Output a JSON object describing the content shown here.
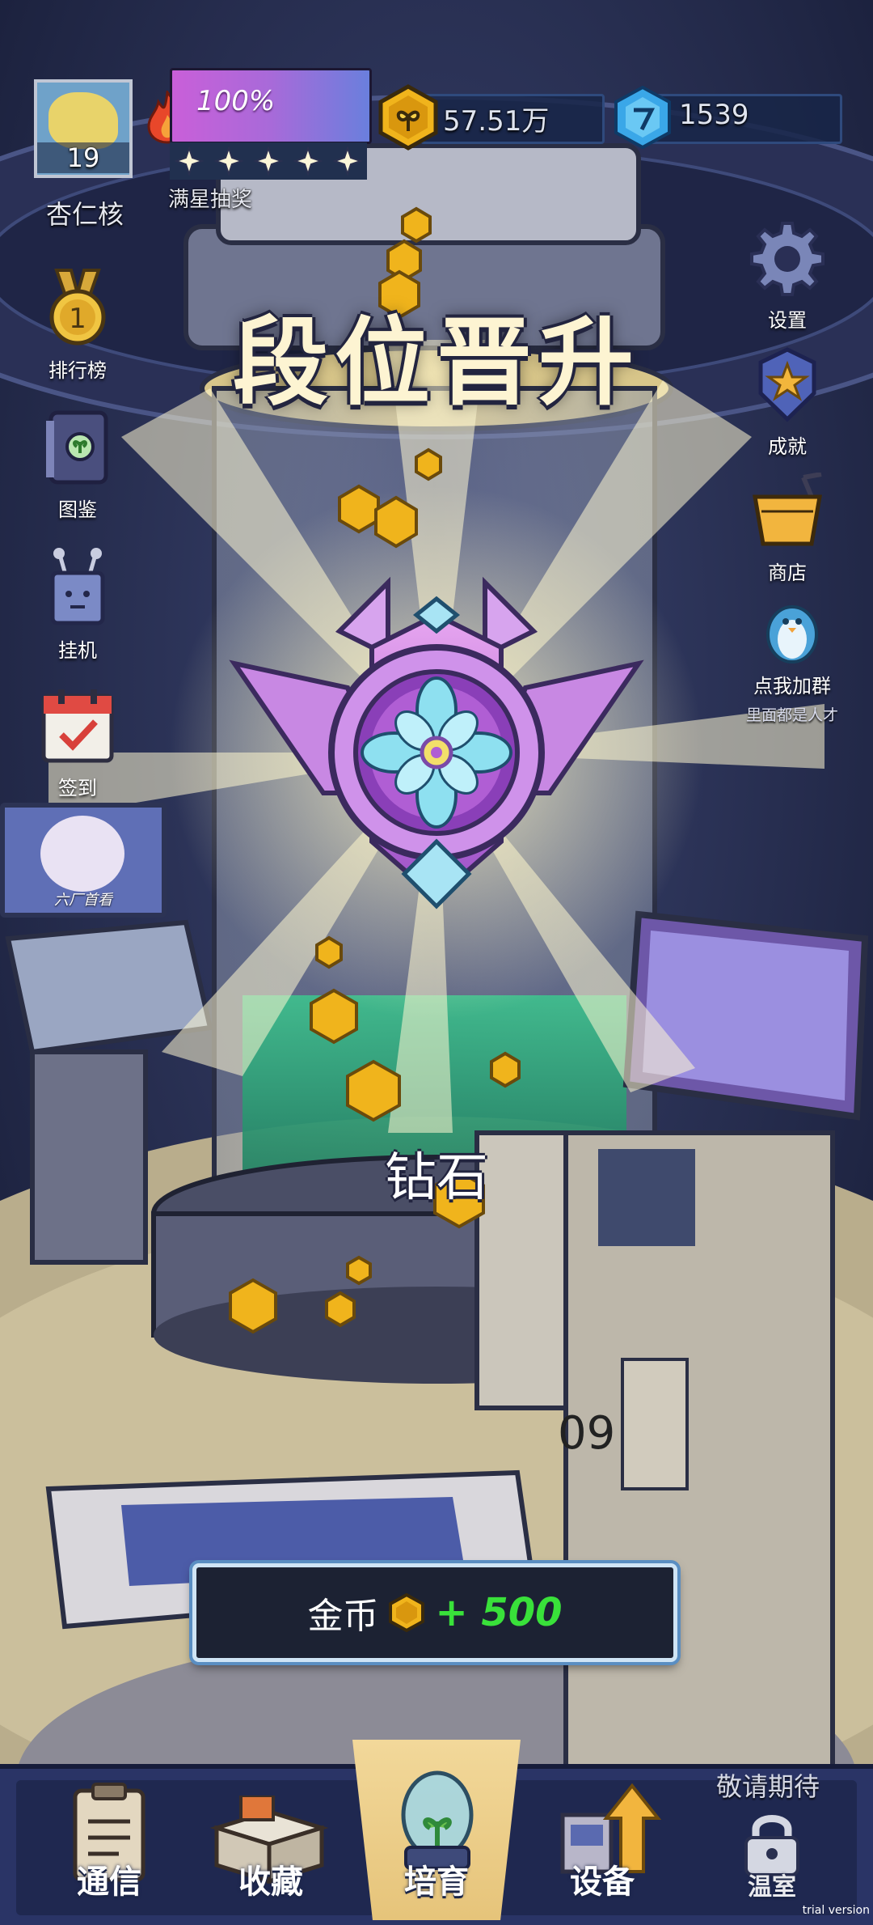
{
  "player": {
    "name": "杏仁核",
    "level": "19"
  },
  "star_bar": {
    "percent_text": "100%",
    "progress": 1.0,
    "stars_filled": 5,
    "stars_total": 5,
    "label": "满星抽奖"
  },
  "currency": {
    "coins": "57.51万",
    "gems": "1539"
  },
  "left_menu": [
    {
      "label": "排行榜",
      "icon": "medal-icon"
    },
    {
      "label": "图鉴",
      "icon": "book-icon"
    },
    {
      "label": "挂机",
      "icon": "robot-icon"
    },
    {
      "label": "签到",
      "icon": "calendar-icon"
    }
  ],
  "ad_banner": {
    "label": "六厂首看"
  },
  "right_menu": [
    {
      "label": "设置",
      "icon": "gear-icon"
    },
    {
      "label": "成就",
      "icon": "achievement-icon"
    },
    {
      "label": "商店",
      "icon": "shop-icon"
    },
    {
      "label": "点我加群",
      "sub": "里面都是人才",
      "icon": "penguin-icon"
    }
  ],
  "promotion": {
    "title": "段位晋升",
    "rank_name": "钻石",
    "reward_label": "金币",
    "reward_amount": "+ 500"
  },
  "scene_text": {
    "machine_number": "09"
  },
  "bottom_nav": {
    "coming_soon": "敬请期待",
    "items": [
      {
        "label": "通信",
        "icon": "clipboard-icon"
      },
      {
        "label": "收藏",
        "icon": "box-icon"
      },
      {
        "label": "培育",
        "icon": "sprout-jar-icon"
      },
      {
        "label": "设备",
        "icon": "upgrade-arrow-icon"
      },
      {
        "label": "温室",
        "icon": "lock-icon"
      }
    ]
  },
  "watermark": "trial version",
  "colors": {
    "accent_pink": "#c86ad8",
    "reward_green": "#39e13a",
    "coin_gold": "#f0b41c",
    "gem_blue": "#3aa7e8",
    "panel_dark": "#1c2233"
  }
}
